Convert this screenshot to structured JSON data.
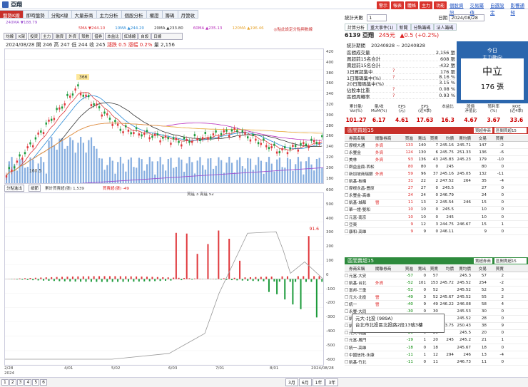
{
  "app": {
    "title": "亞翔"
  },
  "top_buttons": [
    "警示",
    "報表",
    "體格",
    "主力",
    "功能"
  ],
  "top_links": [
    "個股資訊",
    "交易屬值",
    "自選設定",
    "影響通知"
  ],
  "tabs": [
    "盤勢K線",
    "即時盤勢",
    "分點K線",
    "大量券商",
    "主力分析",
    "個股分析",
    "權證",
    "籌碼",
    "月營收"
  ],
  "ma_bar": {
    "m240": "240MA ▼188.79",
    "m5": "5MA ▼244.10",
    "m10": "10MA ▲244.20",
    "m20": "20MA ▲233.80",
    "m60": "60MA ▲235.13",
    "m120": "120MA ▲196.46",
    "hint": "◎點此設定分點與數線"
  },
  "toolbar": [
    "均線",
    "K架",
    "投資",
    "主力",
    "融資",
    "外資",
    "殼數",
    "借券",
    "本益比",
    "紅綠線",
    "自設"
  ],
  "toolbar_select": "日線",
  "info_line": {
    "date": "2024/08/28",
    "open": "開 246",
    "high": "高 247",
    "low": "低 244",
    "close": "收 245",
    "chg": "漲跌 0.5",
    "pct": "漲幅 0.2%",
    "vol": "量 2,156"
  },
  "price_axis": [
    "420",
    "400",
    "380",
    "360",
    "340",
    "320",
    "300",
    "280",
    "260",
    "240",
    "220",
    "200",
    "180"
  ],
  "price_callouts": {
    "hi": "366",
    "lo": "160.5"
  },
  "lower_axis": [
    "600",
    "500",
    "400",
    "300",
    "200",
    "100",
    "0",
    "-100",
    "-200",
    "-300",
    "-400",
    "-500",
    "-600"
  ],
  "lower_callout": "91.6",
  "sub1": {
    "select": "分點進出",
    "btn": "細節",
    "legend1": "累計買賣超(張) 1,539",
    "legend2": "買賣超(張) -49",
    "legend3": "買進 3 賣進 52"
  },
  "dates": [
    "2/28",
    "4/01",
    "5/02",
    "6/03",
    "7/01",
    "8/01",
    "2024/08/28"
  ],
  "date_year": "2024",
  "pager": [
    "1",
    "2",
    "3",
    "4",
    "5",
    "6"
  ],
  "range_btns": [
    "3月",
    "6月",
    "1年",
    "3年"
  ],
  "right": {
    "sel1": "統計天數",
    "sel1v": "1",
    "tabs": [
      "計算分析",
      "重大事件(1)",
      "新聞",
      "分點籌碼",
      "法人籌碼"
    ],
    "date_label": "日期",
    "date": "2024/08/28",
    "stock": "6139 亞翔",
    "price": "245元",
    "chg": "▲0.5 (+0.2%)",
    "period_label": "統計期間",
    "period": "20240828 ~ 20240828",
    "kv": [
      {
        "k": "區間成交量",
        "m": "",
        "v": "2,156 張"
      },
      {
        "k": "買超前15名合計",
        "m": "",
        "v": "608 張"
      },
      {
        "k": "賣超前15名合計",
        "m": "",
        "v": "-432 張"
      },
      {
        "k": "1日買超集中",
        "m": "?",
        "v": "176 張"
      },
      {
        "k": "1日籌碼集中(%)",
        "m": "?",
        "v": "8.16 %"
      },
      {
        "k": "20日籌碼集中(%)",
        "m": "",
        "v": "3.15 %"
      },
      {
        "k": "佔股本比重",
        "m": "?",
        "v": "0.08 %"
      },
      {
        "k": "區間周轉率",
        "m": "?",
        "v": "0.93 %"
      }
    ],
    "today_title": "今日",
    "today_sub": "主力動向",
    "today_big": "中立",
    "today_val": "176 張",
    "stats_labels": [
      "累計量/\nVol(%)",
      "量/收\nMoM(%)",
      "EPS\n(元)",
      "EPS\n(近4季)",
      "本益比",
      "股價\n淨值比",
      "殖利率\n(%)",
      "ROE\n(近4季)"
    ],
    "stats_values": [
      "101.27",
      "6.17",
      "4.61",
      "17.63",
      "16.3",
      "4.67",
      "3.67",
      "33.6"
    ],
    "buy_title": "區間買超15",
    "buy_filter": "買超券商",
    "buy_filter2": "區間買超15",
    "headers": [
      "券商名稱",
      "關聯券商",
      "買進",
      "賣出",
      "買賣",
      "均價",
      "賣均價",
      "交易",
      "買賣"
    ],
    "buy_rows": [
      [
        "摩根大通",
        "外資",
        "133",
        "140",
        "7",
        "245.16",
        "245.71",
        "147",
        "-2"
      ],
      [
        "永豐金",
        "外資",
        "124",
        "130",
        "6",
        "245.75",
        "251.33",
        "136",
        "-6"
      ],
      [
        "美林",
        "外資",
        "93",
        "136",
        "43",
        "245.83",
        "245.23",
        "179",
        "-10"
      ],
      [
        "群益金鼎-西松",
        "",
        "80",
        "80",
        "0",
        "245",
        "",
        "80",
        "0"
      ],
      [
        "新加坡商瑞銀",
        "外資",
        "59",
        "96",
        "37",
        "245.16",
        "245.05",
        "132",
        "-11"
      ],
      [
        "凱基-板橋",
        "",
        "31",
        "22",
        "2",
        "247.52",
        "264",
        "35",
        "-4"
      ],
      [
        "摩根永昌-豐原",
        "",
        "27",
        "27",
        "0",
        "245.5",
        "",
        "27",
        "0"
      ],
      [
        "永豐金-高雄",
        "",
        "24",
        "24",
        "0",
        "246.79",
        "",
        "24",
        "0"
      ],
      [
        "凱基-城都",
        "營",
        "11",
        "13",
        "2",
        "245.54",
        "246",
        "15",
        "0"
      ],
      [
        "華一證-雙和",
        "",
        "10",
        "10",
        "0",
        "245.5",
        "",
        "10",
        "0"
      ],
      [
        "元富-南京",
        "",
        "10",
        "10",
        "0",
        "245",
        "",
        "10",
        "0"
      ],
      [
        "亞東",
        "",
        "9",
        "12",
        "3",
        "244.75",
        "246.67",
        "15",
        "1"
      ],
      [
        "康和-高雄",
        "",
        "9",
        "9",
        "0",
        "246.11",
        "",
        "9",
        "0"
      ]
    ],
    "sell_title": "區間賣超15",
    "sell_filter": "賣超券商",
    "sell_filter2": "區間賣超15",
    "sell_rows": [
      [
        "元富-大安",
        "",
        "-57",
        "0",
        "57",
        "",
        "245.3",
        "57",
        "2"
      ],
      [
        "凱基-台北",
        "外資",
        "-52",
        "101",
        "153",
        "245.72",
        "245.52",
        "254",
        "-2"
      ],
      [
        "富邦-三重",
        "",
        "-52",
        "0",
        "52",
        "",
        "245.52",
        "52",
        "3"
      ],
      [
        "元大-北投",
        "營",
        "-49",
        "3",
        "52",
        "245.67",
        "245.52",
        "55",
        "2"
      ],
      [
        "統一",
        "營",
        "-40",
        "9",
        "49",
        "246.22",
        "246.08",
        "58",
        "4"
      ],
      [
        "永豐-大同",
        "",
        "-30",
        "0",
        "30",
        "",
        "245.53",
        "30",
        "0"
      ],
      [
        "凱基-台中",
        "",
        "-28",
        "0",
        "28",
        "",
        "245.52",
        "28",
        "0"
      ],
      [
        "凱基",
        "",
        "-22",
        "8",
        "30",
        "253.75",
        "250.43",
        "38",
        "9"
      ],
      [
        "元大-桃園",
        "",
        "-20",
        "0",
        "20",
        "",
        "245.5",
        "20",
        "0"
      ],
      [
        "元富-鳳門",
        "",
        "-19",
        "1",
        "20",
        "245",
        "245.2",
        "21",
        "1"
      ],
      [
        "統一-高雄",
        "",
        "-18",
        "0",
        "18",
        "",
        "245.67",
        "18",
        "0"
      ],
      [
        "中國信託-永康",
        "",
        "-11",
        "1",
        "12",
        "294",
        "246",
        "13",
        "-4"
      ],
      [
        "凱基-竹北",
        "",
        "-11",
        "0",
        "11",
        "",
        "246.73",
        "11",
        "0"
      ]
    ],
    "tooltip": {
      "name": "元大-北投 (989A)",
      "addr": "台北市北投區北投路2段13號3樓"
    }
  },
  "chart_data": [
    {
      "type": "candlestick",
      "title": "",
      "x": [
        "2/28",
        "4/01",
        "5/02",
        "6/03",
        "7/01",
        "8/01",
        "2024/08/28"
      ],
      "ylim": [
        160,
        420
      ],
      "annotations": [
        {
          "label": "366",
          "value": 366
        },
        {
          "label": "160.5",
          "value": 160.5
        }
      ],
      "last": {
        "open": 246,
        "high": 247,
        "low": 244,
        "close": 245,
        "volume": 2156
      }
    },
    {
      "type": "bar",
      "title": "",
      "series": [
        {
          "name": "累計買賣超(張)",
          "last": 1539
        },
        {
          "name": "買賣超(張)",
          "last": -49
        }
      ],
      "ylim": [
        -600,
        600
      ]
    }
  ]
}
